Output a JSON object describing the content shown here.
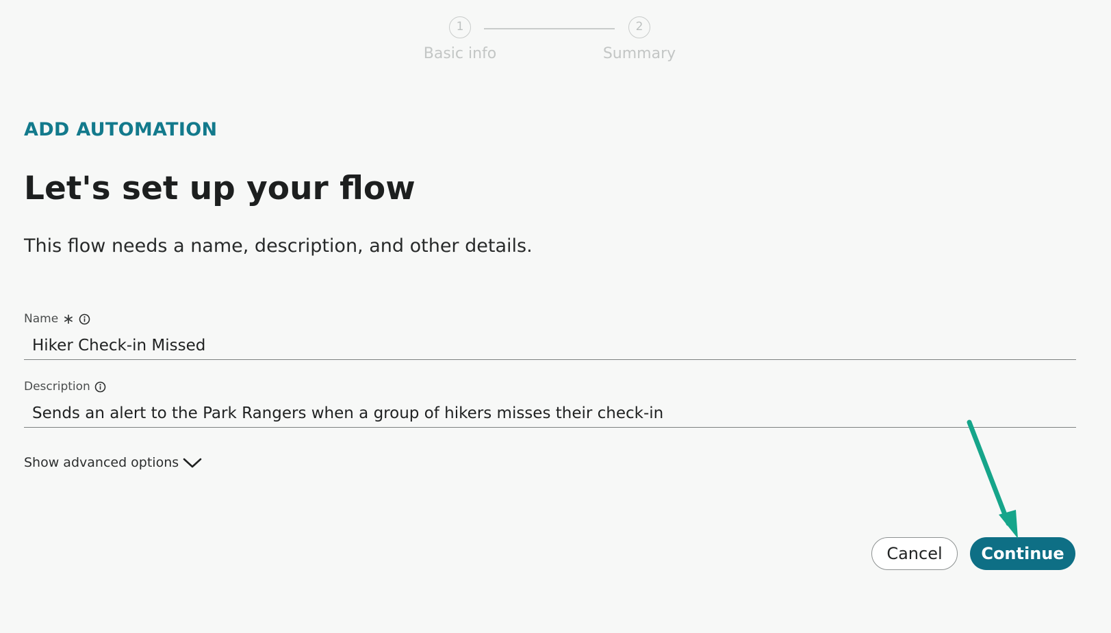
{
  "stepper": {
    "steps": [
      {
        "number": "1",
        "label": "Basic info"
      },
      {
        "number": "2",
        "label": "Summary"
      }
    ]
  },
  "header": {
    "eyebrow": "ADD AUTOMATION",
    "title": "Let's set up your flow",
    "subtitle": "This flow needs a name, description, and other details."
  },
  "form": {
    "name": {
      "label": "Name",
      "required_mark": "∗",
      "value": "Hiker Check-in Missed"
    },
    "description": {
      "label": "Description",
      "value": "Sends an alert to the Park Rangers when a group of hikers misses their check-in"
    },
    "advanced_toggle": "Show advanced options"
  },
  "actions": {
    "cancel_label": "Cancel",
    "continue_label": "Continue"
  },
  "icons": {
    "info": "info-icon",
    "chevron": "chevron-down-icon",
    "annotation": "arrow-annotation"
  },
  "colors": {
    "accent": "#137a8c",
    "primary_button": "#0e6f85",
    "annotation_arrow": "#16a58a",
    "background": "#f7f8f7"
  }
}
